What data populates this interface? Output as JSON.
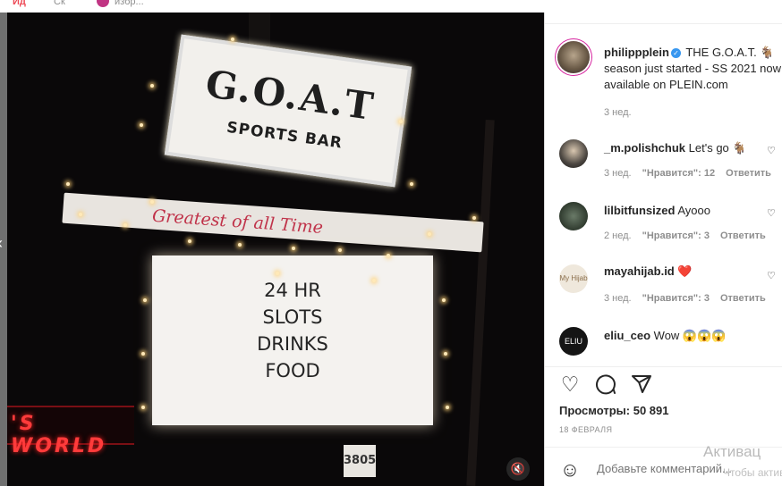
{
  "top": {
    "fragment1": "Йд",
    "fragment2": "Ск",
    "fragment4": "избр..."
  },
  "media": {
    "goat_title": "G.O.A.T",
    "goat_sub": "SPORTS BAR",
    "banner": "Greatest of all Time",
    "marquee": [
      "24 HR",
      "SLOTS",
      "DRINKS",
      "FOOD"
    ],
    "world_sign": "'S WORLD",
    "address": "3805",
    "mute_icon": "speaker-muted-icon"
  },
  "post": {
    "author": "philippplein",
    "caption_text": "THE G.O.A.T. 🐐 season just started - SS 2021 now available on PLEIN.com",
    "caption_time": "3 нед.",
    "views_label": "Просмотры:",
    "views_value": "50 891",
    "date": "18 ФЕВРАЛЯ",
    "add_comment_placeholder": "Добавьте комментарий..."
  },
  "comments": [
    {
      "user": "_m.polishchuk",
      "text": "Let's go 🐐",
      "time": "3 нед.",
      "likes": "\"Нравится\": 12",
      "reply": "Ответить"
    },
    {
      "user": "lilbitfunsized",
      "text": "Ayooo",
      "time": "2 нед.",
      "likes": "\"Нравится\": 3",
      "reply": "Ответить"
    },
    {
      "user": "mayahijab.id",
      "text": "❤️",
      "time": "3 нед.",
      "likes": "\"Нравится\": 3",
      "reply": "Ответить"
    },
    {
      "user": "eliu_ceo",
      "text": "Wow 😱😱😱"
    }
  ],
  "avatars": {
    "mayahijab": "My Hijab",
    "eliu": "ELIU"
  },
  "watermark": {
    "line1": "Активац",
    "line2": "Чтобы актив"
  },
  "icons": {
    "like": "heart-icon",
    "comment": "comment-icon",
    "share": "share-icon",
    "emoji": "smiley-icon",
    "verified": "verified-badge-icon"
  }
}
